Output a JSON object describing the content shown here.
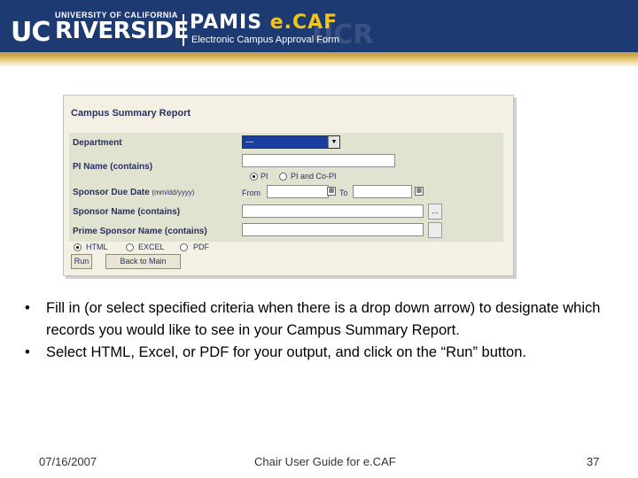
{
  "header": {
    "uc": "UC",
    "university": "UNIVERSITY OF CALIFORNIA",
    "campus": "RIVERSIDE",
    "app_name": "PAMIS",
    "app_brand": "e.CAF",
    "app_subtitle": "Electronic Campus Approval Form",
    "watermark": "UCR"
  },
  "form": {
    "title": "Campus Summary Report",
    "department_label": "Department",
    "department_value": "---",
    "pi_name_label": "PI Name (contains)",
    "pi_name_value": "",
    "pi_radio_pi": "PI",
    "pi_radio_copi": "PI and Co-PI",
    "due_date_label": "Sponsor Due Date",
    "due_date_format": "(mm/dd/yyyy)",
    "from_label": "From",
    "to_label": "To",
    "from_value": "",
    "to_value": "",
    "sponsor_name_label": "Sponsor Name (contains)",
    "sponsor_name_value": "",
    "prime_sponsor_label": "Prime Sponsor Name (contains)",
    "prime_sponsor_value": "",
    "ellipsis": "...",
    "output_html": "HTML",
    "output_excel": "EXCEL",
    "output_pdf": "PDF",
    "run_button": "Run",
    "back_button": "Back to Main"
  },
  "bullets": [
    "Fill in (or select specified criteria when there is a drop down arrow) to designate which records you would like to see in your Campus Summary Report.",
    "Select HTML, Excel, or PDF for your output, and click on the “Run” button."
  ],
  "footer": {
    "date": "07/16/2007",
    "title": "Chair User Guide for e.CAF",
    "page": "37"
  }
}
